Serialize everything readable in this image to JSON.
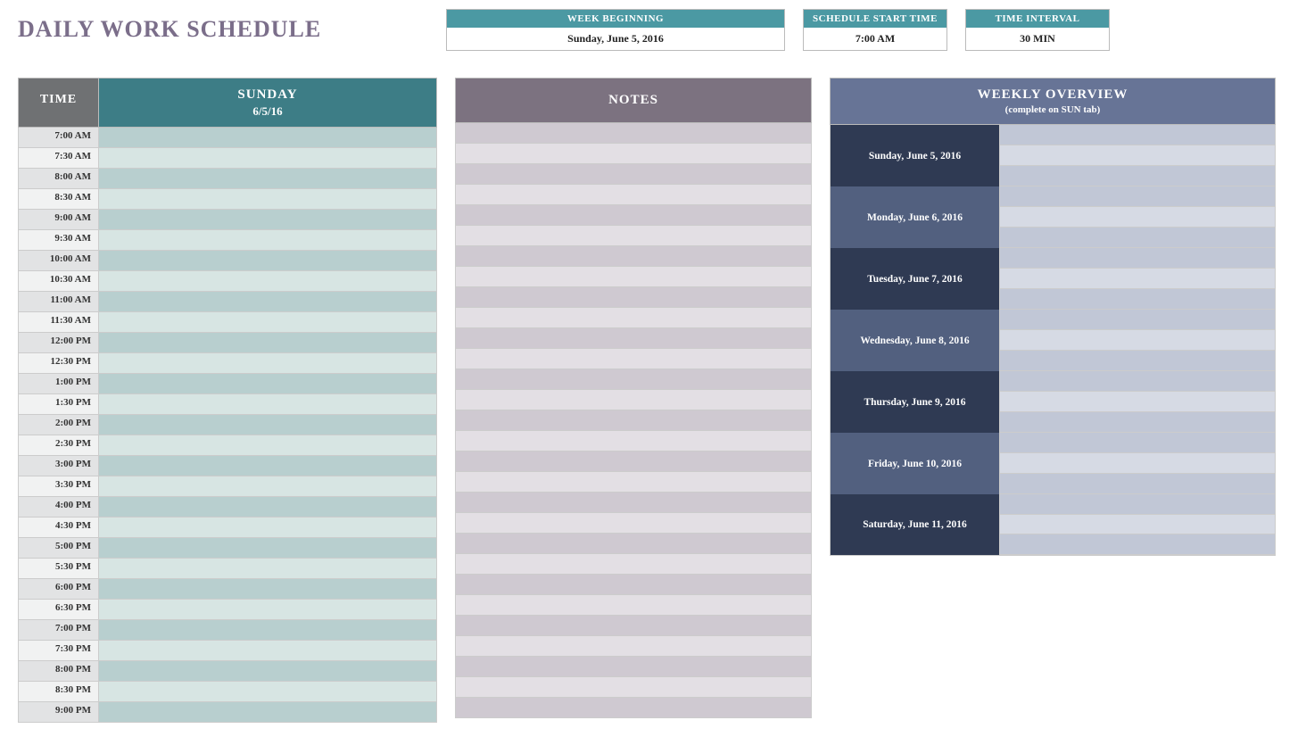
{
  "title": "DAILY WORK SCHEDULE",
  "info": {
    "week_beginning_label": "WEEK BEGINNING",
    "week_beginning_value": "Sunday, June 5, 2016",
    "start_time_label": "SCHEDULE START TIME",
    "start_time_value": "7:00 AM",
    "interval_label": "TIME INTERVAL",
    "interval_value": "30 MIN"
  },
  "schedule": {
    "time_header": "TIME",
    "day_name": "SUNDAY",
    "day_date": "6/5/16",
    "times": [
      "7:00 AM",
      "7:30 AM",
      "8:00 AM",
      "8:30 AM",
      "9:00 AM",
      "9:30 AM",
      "10:00 AM",
      "10:30 AM",
      "11:00 AM",
      "11:30 AM",
      "12:00 PM",
      "12:30 PM",
      "1:00 PM",
      "1:30 PM",
      "2:00 PM",
      "2:30 PM",
      "3:00 PM",
      "3:30 PM",
      "4:00 PM",
      "4:30 PM",
      "5:00 PM",
      "5:30 PM",
      "6:00 PM",
      "6:30 PM",
      "7:00 PM",
      "7:30 PM",
      "8:00 PM",
      "8:30 PM",
      "9:00 PM"
    ]
  },
  "notes": {
    "header": "NOTES",
    "row_count": 29
  },
  "overview": {
    "header": "WEEKLY OVERVIEW",
    "sub": "(complete on SUN tab)",
    "days": [
      "Sunday, June 5, 2016",
      "Monday, June 6, 2016",
      "Tuesday, June 7, 2016",
      "Wednesday, June 8, 2016",
      "Thursday, June 9, 2016",
      "Friday, June 10, 2016",
      "Saturday, June 11, 2016"
    ]
  }
}
